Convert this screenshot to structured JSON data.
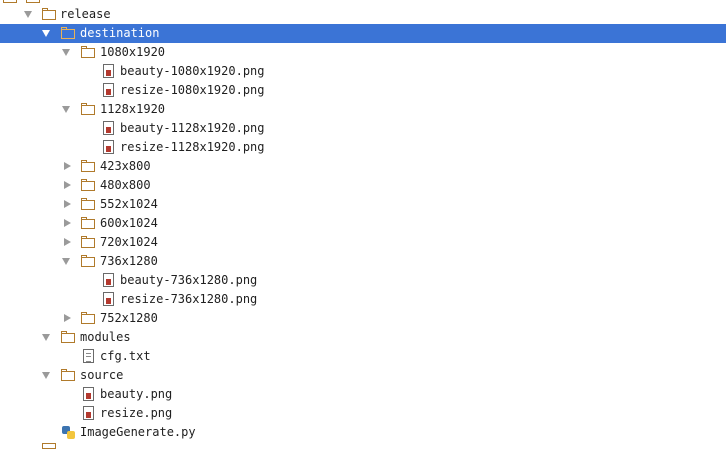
{
  "tree": {
    "release": {
      "label": "release"
    },
    "destination": {
      "label": "destination"
    },
    "r1080": {
      "label": "1080x1920"
    },
    "beauty1080": {
      "label": "beauty-1080x1920.png"
    },
    "resize1080": {
      "label": "resize-1080x1920.png"
    },
    "r1128": {
      "label": "1128x1920"
    },
    "beauty1128": {
      "label": "beauty-1128x1920.png"
    },
    "resize1128": {
      "label": "resize-1128x1920.png"
    },
    "r423": {
      "label": "423x800"
    },
    "r480": {
      "label": "480x800"
    },
    "r552": {
      "label": "552x1024"
    },
    "r600": {
      "label": "600x1024"
    },
    "r720": {
      "label": "720x1024"
    },
    "r736": {
      "label": "736x1280"
    },
    "beauty736": {
      "label": "beauty-736x1280.png"
    },
    "resize736": {
      "label": "resize-736x1280.png"
    },
    "r752": {
      "label": "752x1280"
    },
    "modules": {
      "label": "modules"
    },
    "cfg": {
      "label": "cfg.txt"
    },
    "source": {
      "label": "source"
    },
    "beauty": {
      "label": "beauty.png"
    },
    "resize": {
      "label": "resize.png"
    },
    "imagegen": {
      "label": "ImageGenerate.py"
    }
  },
  "icons": {
    "folder": "folder-icon",
    "image": "image-file-icon",
    "text": "text-file-icon",
    "python": "python-file-icon"
  },
  "colors": {
    "selection": "#3b74d6",
    "folder": "#b07a2b"
  }
}
